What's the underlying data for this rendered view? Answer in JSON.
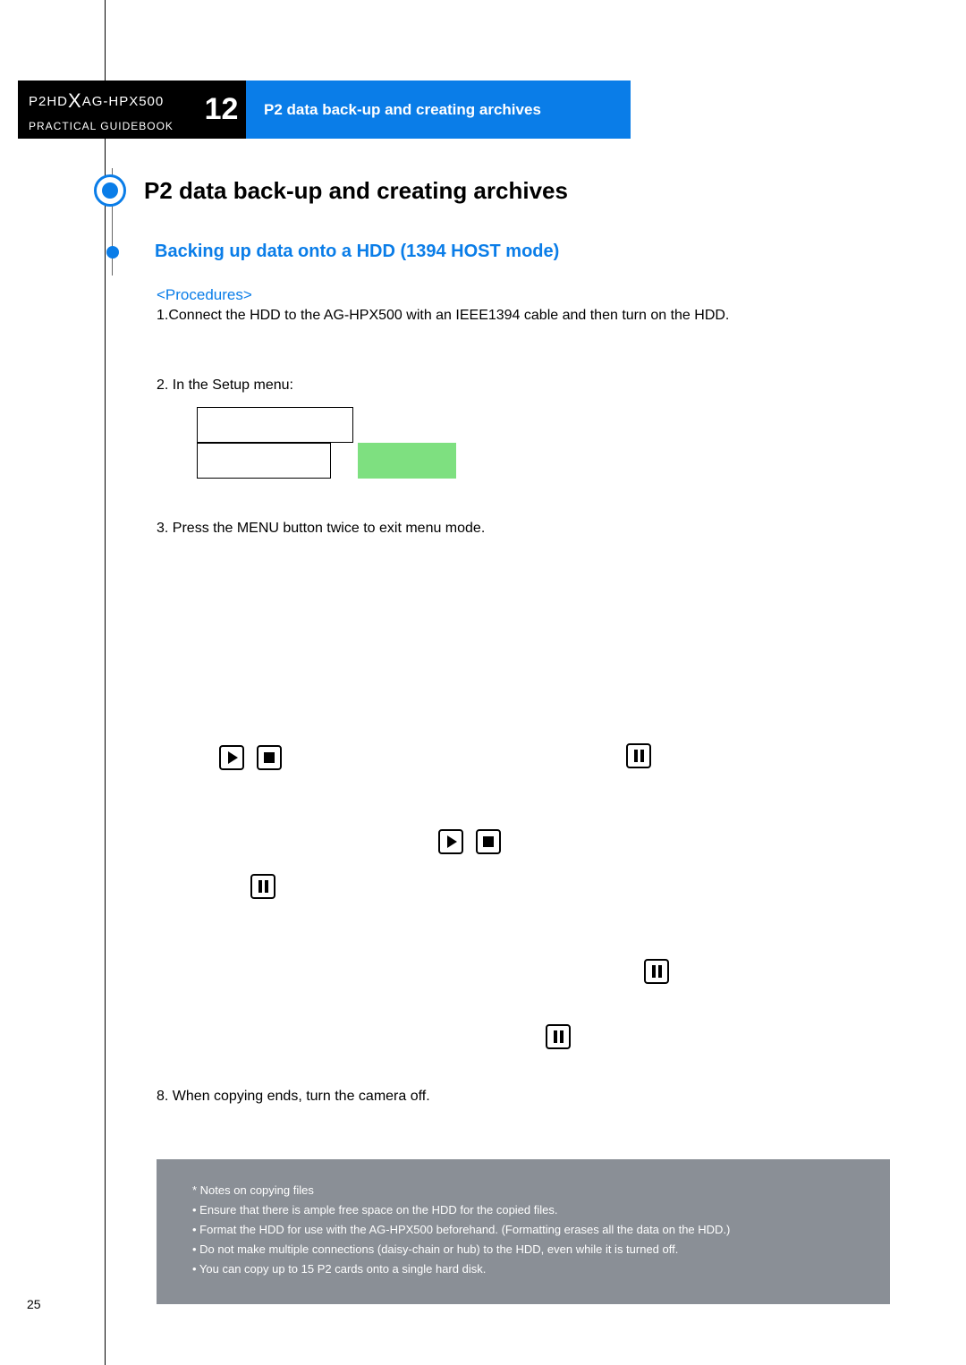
{
  "header": {
    "product_line": "P2HD",
    "model": "AG-HPX500",
    "subtitle": "PRACTICAL GUIDEBOOK"
  },
  "section_number": "12",
  "banner_title": "P2 data back-up and creating archives",
  "main_heading": "P2 data back-up and creating archives",
  "sub_heading": "Backing up data onto a HDD (1394 HOST mode)",
  "procedures_label": "<Procedures>",
  "steps": {
    "s1": "1.Connect the HDD to the AG-HPX500 with an IEEE1394 cable and then turn on the HDD.",
    "s2": "2. In the Setup menu:",
    "s3": "3. Press the MENU button twice to exit menu mode.",
    "s8": "8. When copying ends, turn the camera off."
  },
  "notes": {
    "title": "* Notes on copying files",
    "items": [
      "• Ensure that there is ample free space on the HDD for the copied files.",
      "• Format the HDD for use with the AG-HPX500 beforehand. (Formatting erases all the data on the HDD.)",
      "• Do not make multiple connections (daisy-chain or hub) to the HDD, even while it is turned off.",
      "• You can copy up to 15 P2 cards onto a single hard disk."
    ]
  },
  "page_number": "25"
}
